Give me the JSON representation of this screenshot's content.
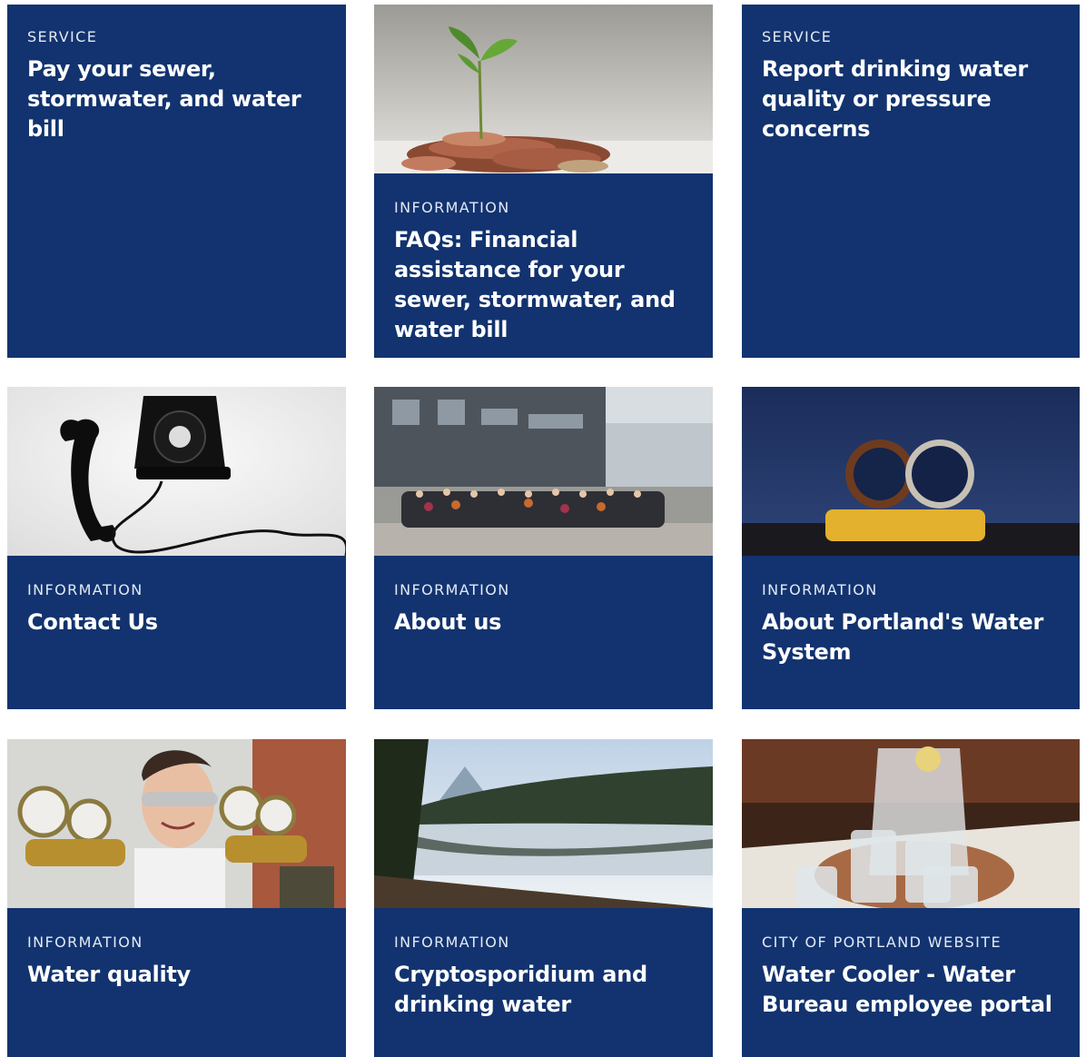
{
  "cards": [
    {
      "kicker": "SERVICE",
      "title": "Pay your sewer, stormwater, and water bill",
      "image": null
    },
    {
      "kicker": "INFORMATION",
      "title": "FAQs: Financial assistance for your sewer, stormwater, and water bill",
      "image": "plant-sprouting-from-coins"
    },
    {
      "kicker": "SERVICE",
      "title": "Report drinking water quality or pressure concerns",
      "image": null
    },
    {
      "kicker": "INFORMATION",
      "title": "Contact Us",
      "image": "black-rotary-telephone"
    },
    {
      "kicker": "INFORMATION",
      "title": "About us",
      "image": "staff-group-photo"
    },
    {
      "kicker": "INFORMATION",
      "title": "About Portland's Water System",
      "image": "pipe-sections-on-sponge"
    },
    {
      "kicker": "INFORMATION",
      "title": "Water quality",
      "image": "scientist-with-gauges"
    },
    {
      "kicker": "INFORMATION",
      "title": "Cryptosporidium and drinking water",
      "image": "mountain-lake-reflection"
    },
    {
      "kicker": "CITY OF PORTLAND WEBSITE",
      "title": "Water Cooler - Water Bureau employee portal",
      "image": "water-pitcher-and-glasses"
    }
  ],
  "colors": {
    "card_background": "#12336f",
    "text": "#ffffff"
  }
}
